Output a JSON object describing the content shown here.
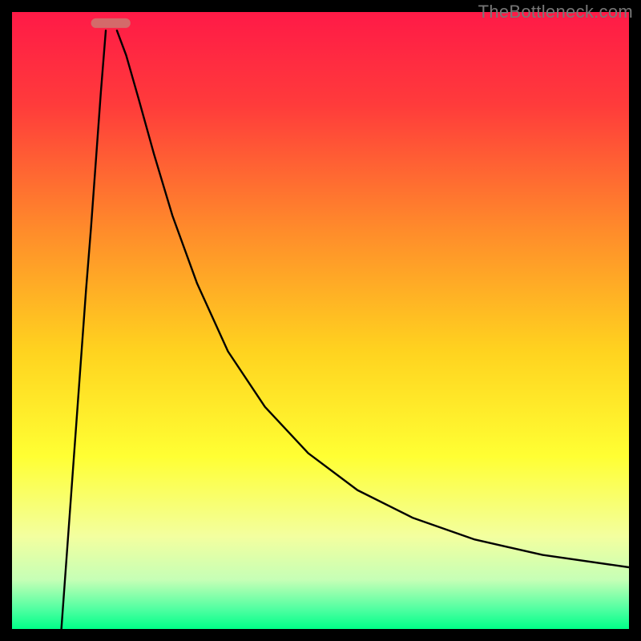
{
  "watermark": "TheBottleneck.com",
  "chart_data": {
    "type": "line",
    "title": "",
    "xlabel": "",
    "ylabel": "",
    "xlim": [
      0,
      100
    ],
    "ylim": [
      0,
      100
    ],
    "grid": false,
    "legend": false,
    "background": {
      "kind": "vertical-gradient",
      "stops": [
        {
          "pos": 0.0,
          "color": "#ff1a47"
        },
        {
          "pos": 0.15,
          "color": "#ff3b3b"
        },
        {
          "pos": 0.35,
          "color": "#ff8a2b"
        },
        {
          "pos": 0.55,
          "color": "#ffd31f"
        },
        {
          "pos": 0.72,
          "color": "#ffff33"
        },
        {
          "pos": 0.85,
          "color": "#f3ff9f"
        },
        {
          "pos": 0.92,
          "color": "#c6ffb6"
        },
        {
          "pos": 0.97,
          "color": "#4bffa0"
        },
        {
          "pos": 1.0,
          "color": "#00ff88"
        }
      ]
    },
    "marker": {
      "x_center": 16,
      "y": 98.2,
      "half_width": 3.2,
      "color": "#d46a6a"
    },
    "series": [
      {
        "name": "left-branch",
        "x": [
          8.0,
          8.8,
          9.6,
          10.4,
          11.2,
          12.0,
          12.8,
          13.6,
          14.4,
          15.2
        ],
        "y": [
          0.0,
          11.0,
          22.0,
          33.0,
          44.0,
          55.0,
          65.0,
          76.0,
          87.0,
          97.0
        ]
      },
      {
        "name": "right-branch",
        "x": [
          17.0,
          18.5,
          20.5,
          23.0,
          26.0,
          30.0,
          35.0,
          41.0,
          48.0,
          56.0,
          65.0,
          75.0,
          86.0,
          100.0
        ],
        "y": [
          97.0,
          93.0,
          86.0,
          77.0,
          67.0,
          56.0,
          45.0,
          36.0,
          28.5,
          22.5,
          18.0,
          14.5,
          12.0,
          10.0
        ]
      }
    ],
    "note": "y is measured from the bottom green band (0) to the top (100). The curve touches the bottom near x≈16 where the rounded marker sits; the right branch asymptotically levels near y≈10 at the right edge."
  }
}
